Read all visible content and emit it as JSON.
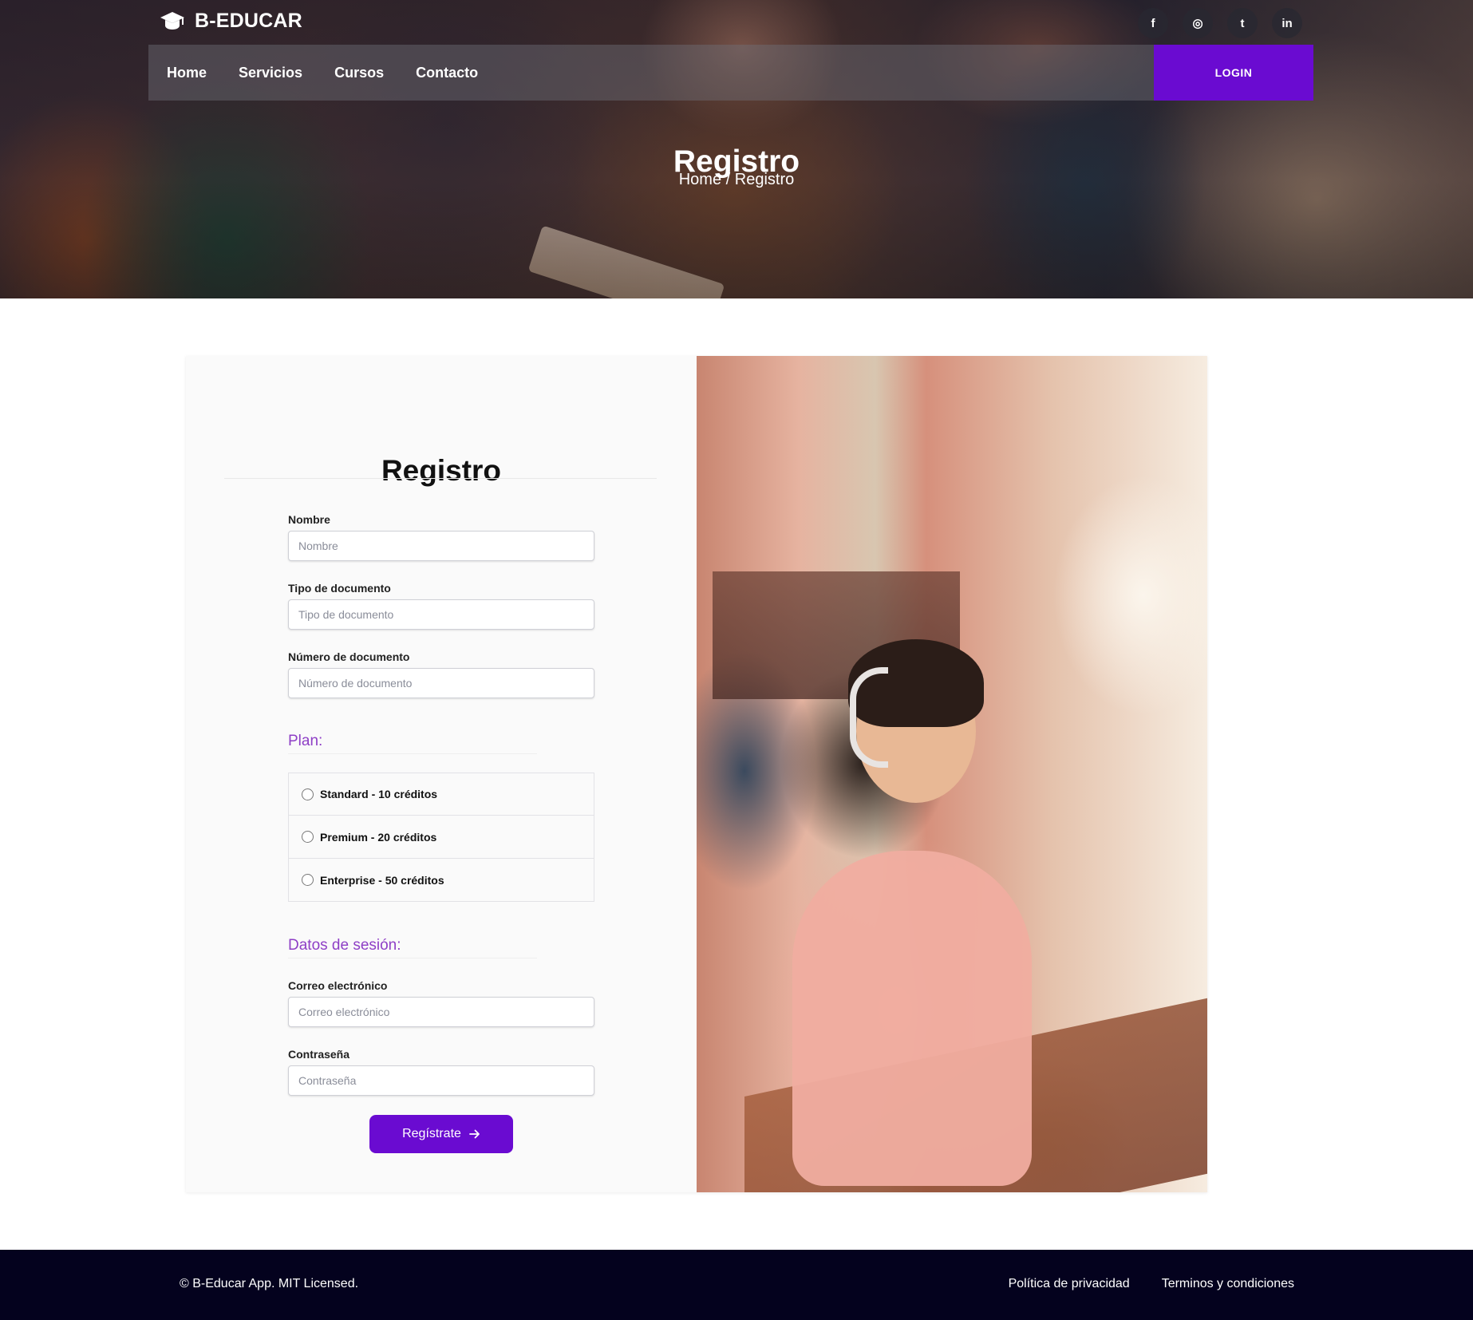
{
  "brand": {
    "name": "B-EDUCAR",
    "logo_icon": "graduation-cap-icon"
  },
  "socials": [
    {
      "icon": "facebook-icon",
      "glyph": "f"
    },
    {
      "icon": "instagram-icon",
      "glyph": "◎"
    },
    {
      "icon": "twitter-icon",
      "glyph": "t"
    },
    {
      "icon": "linkedin-icon",
      "glyph": "in"
    }
  ],
  "nav": {
    "links": [
      "Home",
      "Servicios",
      "Cursos",
      "Contacto"
    ],
    "login_label": "LOGIN"
  },
  "hero": {
    "title": "Registro",
    "breadcrumb_home": "Home",
    "breadcrumb_sep": " / ",
    "breadcrumb_current": "Registro"
  },
  "form": {
    "title": "Registro",
    "fields": {
      "nombre": {
        "label": "Nombre",
        "placeholder": "Nombre"
      },
      "tipo_documento": {
        "label": "Tipo de documento",
        "placeholder": "Tipo de documento"
      },
      "numero_documento": {
        "label": "Número de documento",
        "placeholder": "Número de documento"
      },
      "correo": {
        "label": "Correo electrónico",
        "placeholder": "Correo electrónico"
      },
      "contrasena": {
        "label": "Contraseña",
        "placeholder": "Contraseña"
      }
    },
    "plan_title": "Plan:",
    "plans": [
      "Standard - 10 créditos",
      "Premium - 20 créditos",
      "Enterprise - 50 créditos"
    ],
    "session_title": "Datos de sesión:",
    "submit_label": "Regístrate",
    "submit_icon": "arrow-right-icon"
  },
  "footer": {
    "copyright": "© B-Educar App. MIT Licensed.",
    "links": [
      "Política de privacidad",
      "Terminos y condiciones"
    ]
  },
  "colors": {
    "accent": "#6a0bd1",
    "section_title": "#8e3fc6",
    "footer_bg": "#04021e"
  }
}
